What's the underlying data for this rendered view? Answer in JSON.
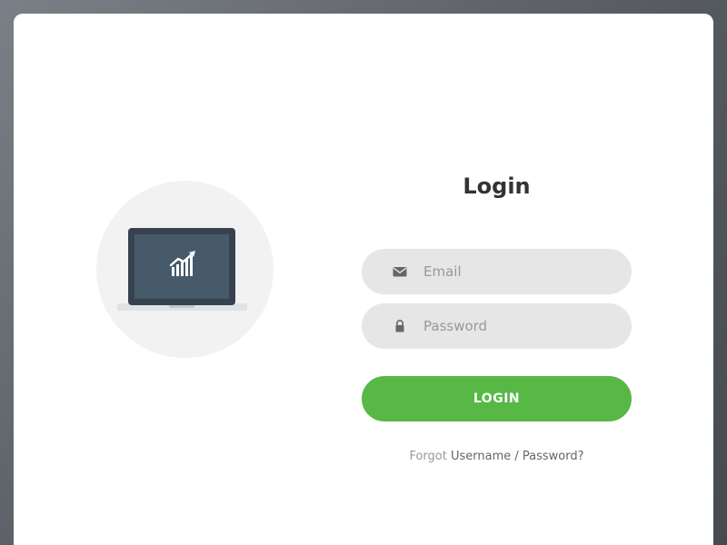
{
  "login": {
    "title": "Login",
    "email": {
      "placeholder": "Email",
      "icon": "envelope-icon"
    },
    "password": {
      "placeholder": "Password",
      "icon": "lock-icon"
    },
    "submit_label": "LOGIN",
    "forgot": {
      "prefix": "Forgot",
      "link_text": "Username / Password?"
    }
  },
  "illustration": {
    "icon": "laptop-chart-icon"
  },
  "colors": {
    "accent": "#57b846",
    "input_bg": "#e6e6e6",
    "card_bg": "#ffffff",
    "title_text": "#333333",
    "muted_text": "#999999"
  }
}
